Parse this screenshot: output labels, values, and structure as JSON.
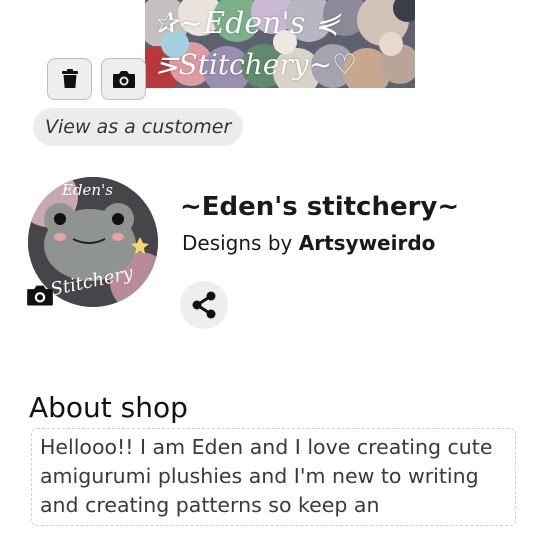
{
  "banner": {
    "text_line1": "✰~Eden's ⋞",
    "text_line2": "⋝Stitchery~♡"
  },
  "toolbar": {
    "delete_icon": "trash-icon",
    "camera_icon": "camera-icon"
  },
  "view_as_customer": "View as a customer",
  "profile": {
    "avatar_text_top": "Eden's",
    "avatar_text_bottom": "Stitchery",
    "avatar_camera_icon": "camera-icon",
    "shop_name": "~Eden's stitchery~",
    "designs_by_prefix": "Designs by",
    "designer": "Artsyweirdo",
    "share_icon": "share-icon"
  },
  "about": {
    "title": "About shop",
    "text": "Hellooo!! I am Eden and I love creating cute amigurumi plushies and I'm new to writing and creating patterns so keep an"
  }
}
